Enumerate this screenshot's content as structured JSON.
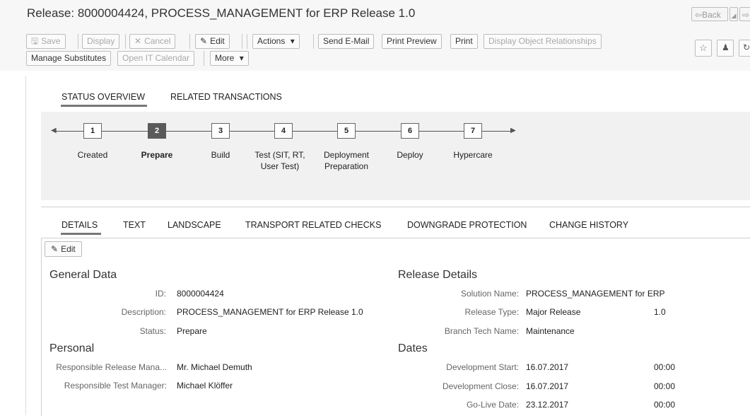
{
  "window": {
    "title": "Release: 8000004424, PROCESS_MANAGEMENT for ERP Release 1.0",
    "back_label": "Back",
    "back_icon": "back-arrow-icon",
    "forward_icon": "forward-arrow-icon"
  },
  "toolbar": {
    "save": "Save",
    "display": "Display",
    "cancel": "Cancel",
    "edit": "Edit",
    "actions": "Actions",
    "send_email": "Send E-Mail",
    "print_preview": "Print Preview",
    "print": "Print",
    "display_object_relationships": "Display Object Relationships",
    "manage_substitutes": "Manage Substitutes",
    "open_it_calendar": "Open IT Calendar",
    "more": "More"
  },
  "top_tabs": {
    "status_overview": "STATUS OVERVIEW",
    "related_transactions": "RELATED TRANSACTIONS"
  },
  "phases": [
    {
      "num": "1",
      "label": "Created"
    },
    {
      "num": "2",
      "label": "Prepare"
    },
    {
      "num": "3",
      "label": "Build"
    },
    {
      "num": "4",
      "label": "Test (SIT, RT, User Test)"
    },
    {
      "num": "5",
      "label": "Deployment Preparation"
    },
    {
      "num": "6",
      "label": "Deploy"
    },
    {
      "num": "7",
      "label": "Hypercare"
    }
  ],
  "active_phase": "2",
  "detail_tabs": {
    "details": "DETAILS",
    "text": "TEXT",
    "landscape": "LANDSCAPE",
    "transport_checks": "TRANSPORT RELATED CHECKS",
    "downgrade_protection": "DOWNGRADE PROTECTION",
    "change_history": "CHANGE HISTORY"
  },
  "details_edit": "Edit",
  "general": {
    "title": "General Data",
    "id_label": "ID:",
    "id_value": "8000004424",
    "description_label": "Description:",
    "description_value": "PROCESS_MANAGEMENT for ERP Release 1.0",
    "status_label": "Status:",
    "status_value": "Prepare"
  },
  "personal": {
    "title": "Personal",
    "release_manager_label": "Responsible Release Mana...",
    "release_manager_value": "Mr. Michael Demuth",
    "test_manager_label": "Responsible Test Manager:",
    "test_manager_value": "Michael Klöffer"
  },
  "release_details": {
    "title": "Release Details",
    "solution_label": "Solution Name:",
    "solution_value": "PROCESS_MANAGEMENT for ERP",
    "type_label": "Release Type:",
    "type_value": "Major Release",
    "type_version": "1.0",
    "branch_label": "Branch Tech Name:",
    "branch_value": "Maintenance"
  },
  "dates": {
    "title": "Dates",
    "dev_start_label": "Development Start:",
    "dev_start_date": "16.07.2017",
    "dev_start_time": "00:00",
    "dev_close_label": "Development Close:",
    "dev_close_date": "16.07.2017",
    "dev_close_time": "00:00",
    "golive_label": "Go-Live Date:",
    "golive_date": "23.12.2017",
    "golive_time": "00:00"
  },
  "colors": {
    "active_step": "#5a5a5a",
    "tab_underline": "#777777",
    "phase_background": "#f1f1f1"
  }
}
